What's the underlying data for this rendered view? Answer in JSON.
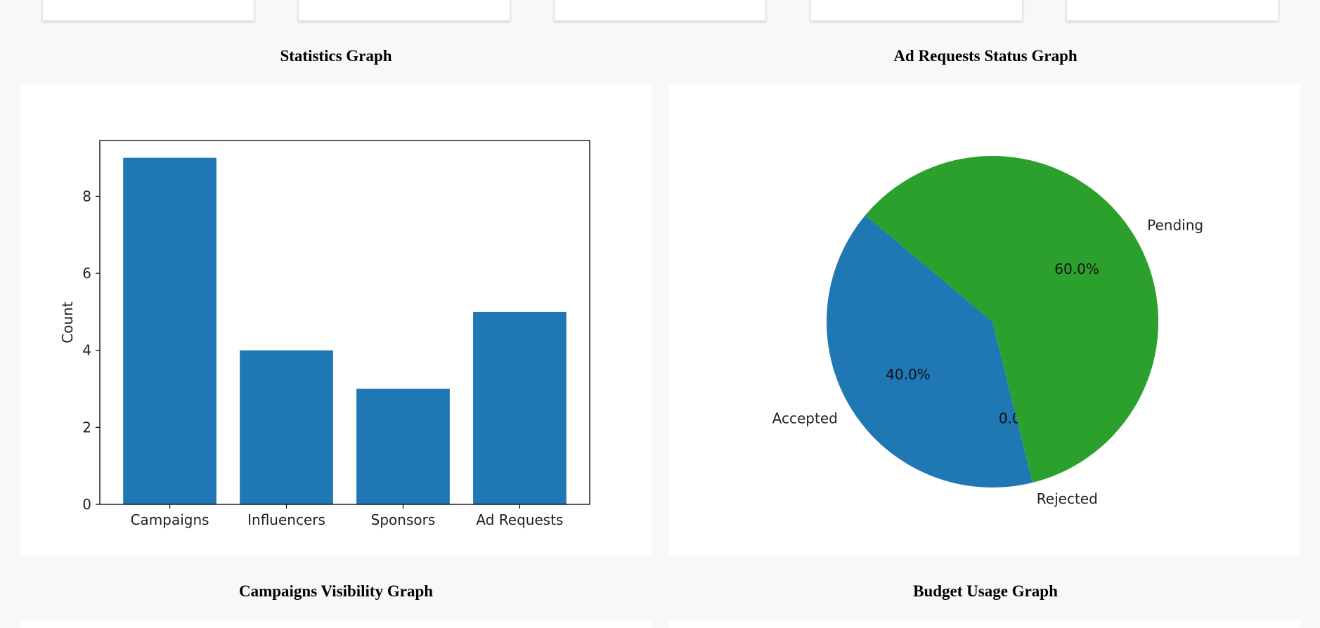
{
  "top_cards": [
    "",
    "",
    "",
    "",
    ""
  ],
  "sections": {
    "statistics_title": "Statistics Graph",
    "ad_requests_title": "Ad Requests Status Graph",
    "campaigns_visibility_title": "Campaigns Visibility Graph",
    "budget_usage_title": "Budget Usage Graph"
  },
  "colors": {
    "bar": "#1f77b4",
    "pie_accepted": "#1f77b4",
    "pie_rejected": "#ff7f0e",
    "pie_pending": "#2ca02c",
    "page_bg": "#f8f8f8"
  },
  "chart_data": [
    {
      "type": "bar",
      "title": "",
      "categories": [
        "Campaigns",
        "Influencers",
        "Sponsors",
        "Ad Requests"
      ],
      "values": [
        9,
        4,
        3,
        5
      ],
      "xlabel": "",
      "ylabel": "Count",
      "ylim": [
        0,
        9.45
      ],
      "yticks": [
        0,
        2,
        4,
        6,
        8
      ],
      "grid": false
    },
    {
      "type": "pie",
      "title": "",
      "labels": [
        "Accepted",
        "Rejected",
        "Pending"
      ],
      "values": [
        40.0,
        0.0,
        60.0
      ],
      "percent_labels": [
        "40.0%",
        "0.0%",
        "60.0%"
      ],
      "start_angle": 140
    }
  ]
}
